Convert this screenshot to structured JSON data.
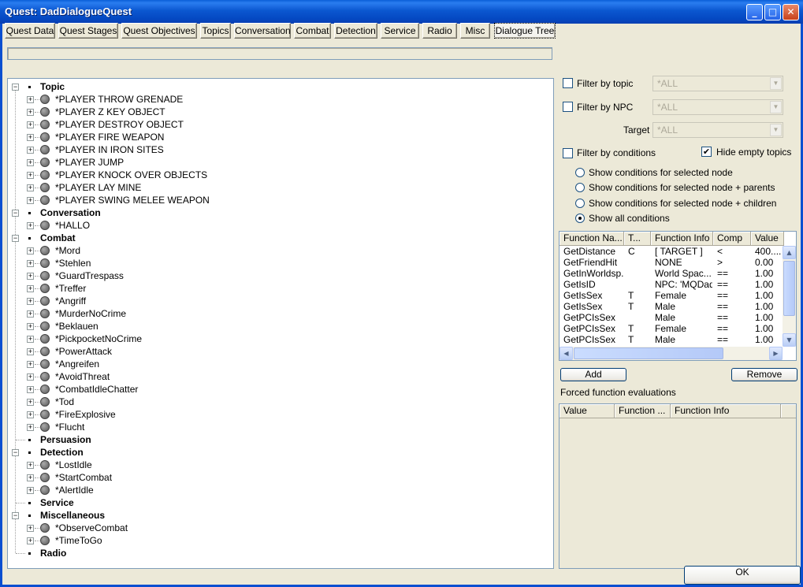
{
  "window": {
    "title": "Quest: DadDialogueQuest"
  },
  "tabs": [
    {
      "label": "Quest Data"
    },
    {
      "label": "Quest Stages"
    },
    {
      "label": "Quest Objectives"
    },
    {
      "label": "Topics"
    },
    {
      "label": "Conversation"
    },
    {
      "label": "Combat"
    },
    {
      "label": "Detection"
    },
    {
      "label": "Service"
    },
    {
      "label": "Radio"
    },
    {
      "label": "Misc"
    },
    {
      "label": "Dialogue Tree",
      "active": true
    }
  ],
  "tree": {
    "nodes": [
      {
        "label": "Topic",
        "cat": true,
        "expanded": true
      },
      {
        "label": "*PLAYER THROW GRENADE"
      },
      {
        "label": "*PLAYER Z KEY OBJECT"
      },
      {
        "label": "*PLAYER DESTROY OBJECT"
      },
      {
        "label": "*PLAYER FIRE WEAPON"
      },
      {
        "label": "*PLAYER IN IRON SITES"
      },
      {
        "label": "*PLAYER JUMP"
      },
      {
        "label": "*PLAYER KNOCK OVER OBJECTS"
      },
      {
        "label": "*PLAYER LAY MINE"
      },
      {
        "label": "*PLAYER SWING MELEE WEAPON"
      },
      {
        "label": "Conversation",
        "cat": true,
        "expanded": true
      },
      {
        "label": "*HALLO"
      },
      {
        "label": "Combat",
        "cat": true,
        "expanded": true
      },
      {
        "label": "*Mord"
      },
      {
        "label": "*Stehlen"
      },
      {
        "label": "*GuardTrespass"
      },
      {
        "label": "*Treffer"
      },
      {
        "label": "*Angriff"
      },
      {
        "label": "*MurderNoCrime"
      },
      {
        "label": "*Beklauen"
      },
      {
        "label": "*PickpocketNoCrime"
      },
      {
        "label": "*PowerAttack"
      },
      {
        "label": "*Angreifen"
      },
      {
        "label": "*AvoidThreat"
      },
      {
        "label": "*CombatIdleChatter"
      },
      {
        "label": "*Tod"
      },
      {
        "label": "*FireExplosive"
      },
      {
        "label": "*Flucht"
      },
      {
        "label": "Persuasion",
        "cat": true,
        "expanded": false
      },
      {
        "label": "Detection",
        "cat": true,
        "expanded": true
      },
      {
        "label": "*LostIdle"
      },
      {
        "label": "*StartCombat"
      },
      {
        "label": "*AlertIdle"
      },
      {
        "label": "Service",
        "cat": true,
        "expanded": false
      },
      {
        "label": "Miscellaneous",
        "cat": true,
        "expanded": true
      },
      {
        "label": "*ObserveCombat"
      },
      {
        "label": "*TimeToGo"
      },
      {
        "label": "Radio",
        "cat": true,
        "expanded": false
      }
    ]
  },
  "filters": {
    "topic_label": "Filter by topic",
    "topic_value": "*ALL",
    "npc_label": "Filter by NPC",
    "npc_value": "*ALL",
    "target_label": "Target",
    "target_value": "*ALL",
    "conditions_label": "Filter by conditions",
    "hide_empty_label": "Hide empty topics",
    "hide_empty_checked": true
  },
  "radios": [
    {
      "label": "Show conditions for selected node",
      "checked": false
    },
    {
      "label": "Show conditions for selected node + parents",
      "checked": false
    },
    {
      "label": "Show conditions for selected node + children",
      "checked": false
    },
    {
      "label": "Show all conditions",
      "checked": true
    }
  ],
  "conditions": {
    "columns": [
      "Function Na...",
      "T...",
      "Function Info",
      "Comp",
      "Value"
    ],
    "rows": [
      [
        "GetDistance",
        "C",
        "[ TARGET ]",
        "<",
        "400...."
      ],
      [
        "GetFriendHit",
        "",
        "NONE",
        ">",
        "0.00"
      ],
      [
        "GetInWorldsp...",
        "",
        "World Spac...",
        "==",
        "1.00"
      ],
      [
        "GetIsID",
        "",
        "NPC: 'MQDad'",
        "==",
        "1.00"
      ],
      [
        "GetIsSex",
        "T",
        "Female",
        "==",
        "1.00"
      ],
      [
        "GetIsSex",
        "T",
        "Male",
        "==",
        "1.00"
      ],
      [
        "GetPCIsSex",
        "",
        "Male",
        "==",
        "1.00"
      ],
      [
        "GetPCIsSex",
        "T",
        "Female",
        "==",
        "1.00"
      ],
      [
        "GetPCIsSex",
        "T",
        "Male",
        "==",
        "1.00"
      ]
    ]
  },
  "buttons": {
    "add": "Add",
    "remove": "Remove",
    "ok": "OK"
  },
  "forced": {
    "label": "Forced function evaluations",
    "columns": [
      "Value",
      "Function ...",
      "Function Info"
    ]
  }
}
